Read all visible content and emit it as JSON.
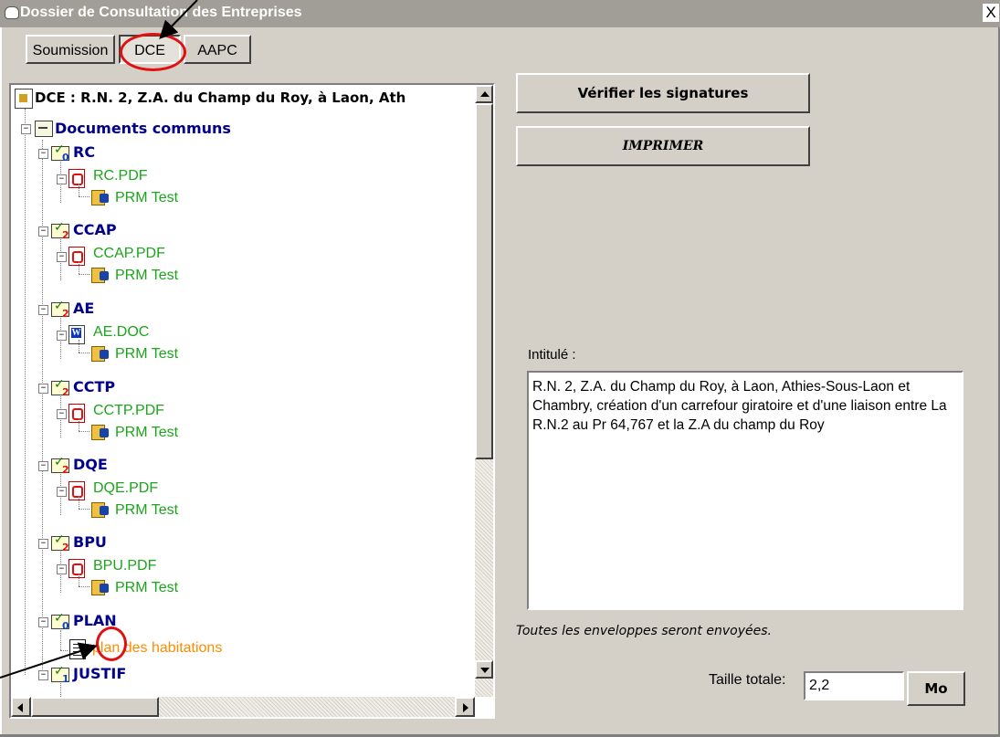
{
  "window": {
    "title": "Dossier de Consultation des Entreprises",
    "close_label": "X"
  },
  "tabs": [
    {
      "label": "Soumission",
      "active": false
    },
    {
      "label": "DCE",
      "active": true
    },
    {
      "label": "AAPC",
      "active": false
    }
  ],
  "tree": {
    "root": "DCE : R.N. 2, Z.A. du Champ du Roy, à Laon, Ath",
    "group": "Documents communs",
    "folders": [
      {
        "name": "RC",
        "count": "0",
        "file": "RC.PDF",
        "file_type": "pdf",
        "signer": "PRM Test"
      },
      {
        "name": "CCAP",
        "count": "2",
        "file": "CCAP.PDF",
        "file_type": "pdf",
        "signer": "PRM Test"
      },
      {
        "name": "AE",
        "count": "2",
        "file": "AE.DOC",
        "file_type": "doc",
        "signer": "PRM Test"
      },
      {
        "name": "CCTP",
        "count": "2",
        "file": "CCTP.PDF",
        "file_type": "pdf",
        "signer": "PRM Test"
      },
      {
        "name": "DQE",
        "count": "2",
        "file": "DQE.PDF",
        "file_type": "pdf",
        "signer": "PRM Test"
      },
      {
        "name": "BPU",
        "count": "2",
        "file": "BPU.PDF",
        "file_type": "pdf",
        "signer": "PRM Test"
      },
      {
        "name": "PLAN",
        "count": "0",
        "file": "plan des habitations",
        "file_type": "note"
      },
      {
        "name": "JUSTIF",
        "count": "1"
      }
    ]
  },
  "actions": {
    "verify_label": "Vérifier les signatures",
    "print_label": "IMPRIMER"
  },
  "intitule": {
    "label": "Intitulé :",
    "text": "R.N. 2, Z.A. du Champ du Roy, à Laon, Athies-Sous-Laon et Chambry, création d'un carrefour giratoire et d'une liaison entre La R.N.2 au Pr 64,767 et la Z.A du champ du Roy"
  },
  "info": "Toutes les enveloppes seront envoyées.",
  "taille": {
    "label": "Taille totale:",
    "value": "2,2",
    "unit_button": "Mo"
  },
  "colors": {
    "folder": "#00008b",
    "file": "#1aa51a",
    "unsigned_file": "#ff8c00",
    "annotation_circle": "#e01010"
  }
}
